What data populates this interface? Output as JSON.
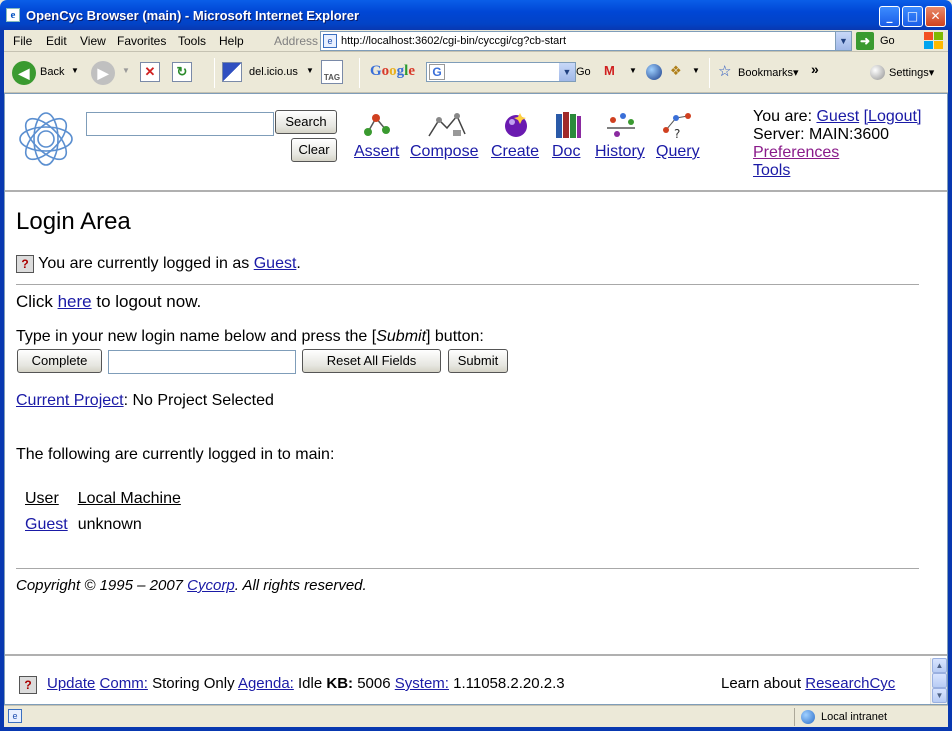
{
  "window": {
    "title": "OpenCyc Browser (main) - Microsoft Internet Explorer"
  },
  "menu": [
    "File",
    "Edit",
    "View",
    "Favorites",
    "Tools",
    "Help"
  ],
  "address": {
    "label": "Address",
    "url": "http://localhost:3602/cgi-bin/cyccgi/cg?cb-start",
    "go": "Go"
  },
  "toolbar": {
    "back": "Back",
    "delicious": "del.icio.us",
    "tag": "TAG",
    "google": "Google",
    "go": "Go",
    "bookmarks": "Bookmarks▾",
    "chevron": "»",
    "settings": "Settings▾"
  },
  "header": {
    "search_button": "Search",
    "clear_button": "Clear",
    "nav": [
      "Assert",
      "Compose",
      "Create",
      "Doc",
      "History",
      "Query"
    ],
    "you_are_label": "You are:",
    "user": "Guest",
    "logout": "[Logout]",
    "server": "Server: MAIN:3600",
    "preferences": "Preferences",
    "tools": "Tools"
  },
  "main": {
    "title": "Login Area",
    "logged_in_text": "You are currently logged in as",
    "logged_in_user": "Guest",
    "logged_in_period": ".",
    "click_text": "Click",
    "here_link": "here",
    "logout_now": "to logout now.",
    "instruction_pre": "Type in your new login name below and press the [",
    "instruction_em": "Submit",
    "instruction_post": "] button:",
    "complete_button": "Complete",
    "reset_button": "Reset All Fields",
    "submit_button": "Submit",
    "current_project_link": "Current Project",
    "current_project_value": ": No Project Selected",
    "logged_in_list_text": "The following are currently logged in to main:",
    "table": {
      "headers": [
        "User",
        "Local Machine"
      ],
      "rows": [
        [
          "Guest",
          "unknown"
        ]
      ]
    },
    "copyright_pre": "Copyright © 1995 – 2007",
    "copyright_link": "Cycorp",
    "copyright_post": ". All rights reserved."
  },
  "footer": {
    "update": "Update",
    "comm_label": "Comm:",
    "comm_value": "Storing Only",
    "agenda_label": "Agenda:",
    "agenda_value": "Idle",
    "kb_label": "KB:",
    "kb_value": "5006",
    "system_label": "System:",
    "system_value": "1.11058.2.20.2.3",
    "learn_text": "Learn about",
    "learn_link": "ResearchCyc"
  },
  "status": {
    "zone": "Local intranet"
  }
}
